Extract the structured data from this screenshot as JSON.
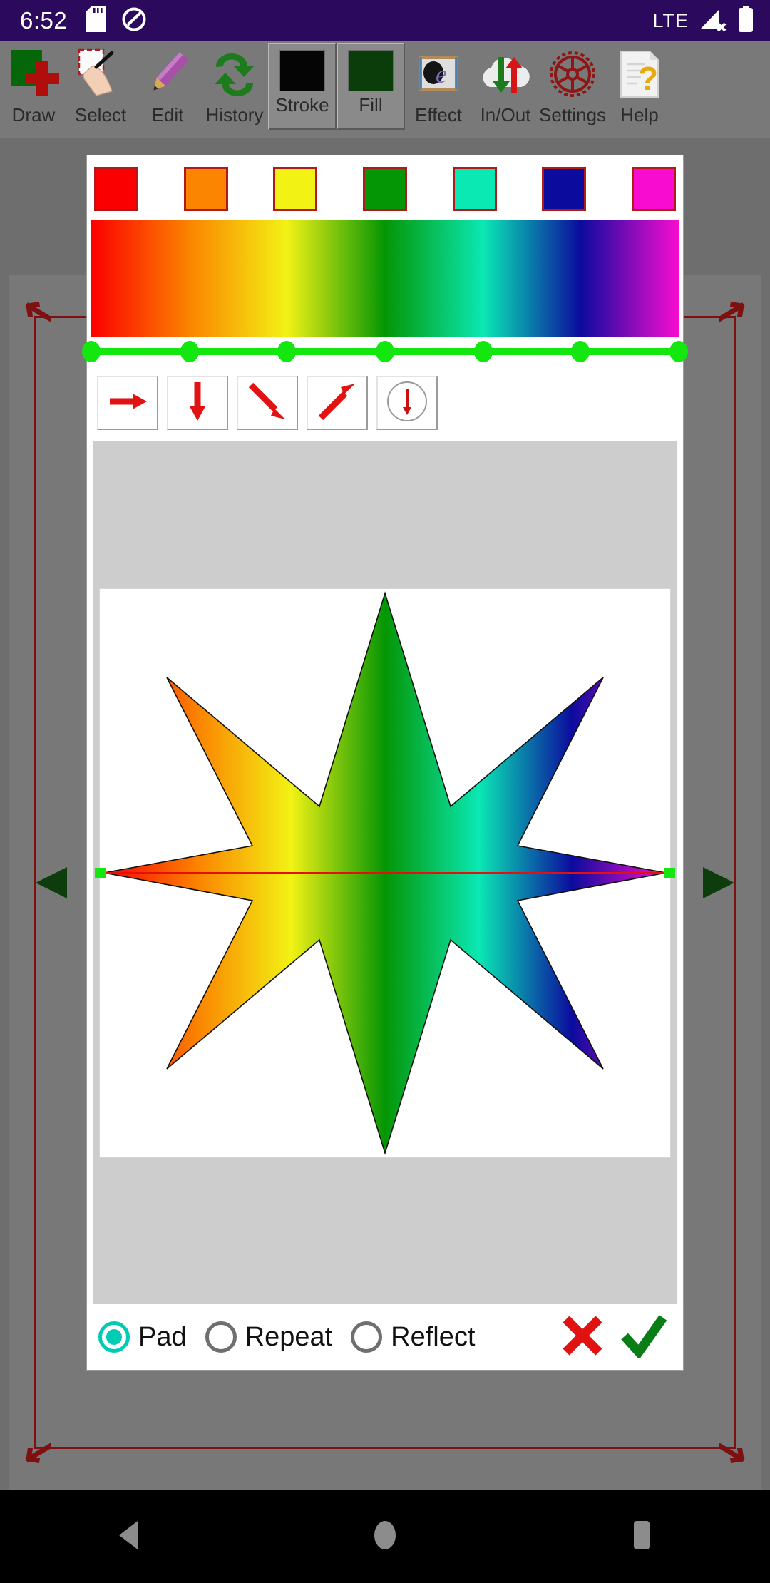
{
  "status_bar": {
    "clock": "6:52",
    "network_label": "LTE",
    "icons": [
      "sd-card-icon",
      "dnd-icon",
      "signal-no-service-icon",
      "battery-icon"
    ]
  },
  "toolbar": {
    "items": [
      {
        "label": "Draw",
        "icon": "draw-new-icon",
        "type": "plain"
      },
      {
        "label": "Select",
        "icon": "select-hand-icon",
        "type": "plain"
      },
      {
        "label": "Edit",
        "icon": "pencil-icon",
        "type": "plain"
      },
      {
        "label": "History",
        "icon": "undo-redo-icon",
        "type": "plain"
      },
      {
        "label": "Stroke",
        "icon": "stroke-swatch",
        "type": "swatch",
        "color": "#050505"
      },
      {
        "label": "Fill",
        "icon": "fill-swatch",
        "type": "swatch",
        "color": "#0b3d0b"
      },
      {
        "label": "Effect",
        "icon": "effect-3d-icon",
        "type": "plain"
      },
      {
        "label": "In/Out",
        "icon": "import-export-icon",
        "type": "plain"
      },
      {
        "label": "Settings",
        "icon": "gear-icon",
        "type": "plain"
      },
      {
        "label": "Help",
        "icon": "help-document-icon",
        "type": "plain"
      }
    ]
  },
  "gradient_dialog": {
    "swatches": [
      {
        "name": "swatch-red",
        "color": "#fb0000"
      },
      {
        "name": "swatch-orange",
        "color": "#fb8400"
      },
      {
        "name": "swatch-yellow",
        "color": "#f2f214"
      },
      {
        "name": "swatch-green",
        "color": "#049604"
      },
      {
        "name": "swatch-spring",
        "color": "#0ae8b4"
      },
      {
        "name": "swatch-navy",
        "color": "#0b0b9e"
      },
      {
        "name": "swatch-magenta",
        "color": "#f80cd0"
      }
    ],
    "gradient_stops": [
      {
        "position": 0,
        "color": "#fb0000"
      },
      {
        "position": 16.7,
        "color": "#fb8400"
      },
      {
        "position": 33.3,
        "color": "#f2f214"
      },
      {
        "position": 50,
        "color": "#049604"
      },
      {
        "position": 66.7,
        "color": "#0ae8b4"
      },
      {
        "position": 83.3,
        "color": "#0b0b9e"
      },
      {
        "position": 100,
        "color": "#f80cd0"
      }
    ],
    "stop_marker_color": "#14e610",
    "direction_buttons": [
      {
        "name": "direction-horizontal-button",
        "icon": "arrow-right-icon",
        "selected": false
      },
      {
        "name": "direction-vertical-button",
        "icon": "arrow-down-icon",
        "selected": false
      },
      {
        "name": "direction-diagonal-down-button",
        "icon": "arrow-down-right-icon",
        "selected": false
      },
      {
        "name": "direction-diagonal-up-button",
        "icon": "arrow-up-right-icon",
        "selected": false
      },
      {
        "name": "direction-radial-button",
        "icon": "radial-gradient-icon",
        "selected": false
      }
    ],
    "preview": {
      "shape": "eight-point-star",
      "background": "#ffffff",
      "axis_color": "#e31010",
      "handle_color": "#14e610"
    },
    "spread_modes": [
      {
        "label": "Pad",
        "selected": true
      },
      {
        "label": "Repeat",
        "selected": false
      },
      {
        "label": "Reflect",
        "selected": false
      }
    ],
    "selected_color": "#00ccb4",
    "actions": [
      {
        "name": "cancel-button",
        "icon": "red-x-icon",
        "color": "#e11212"
      },
      {
        "name": "confirm-button",
        "icon": "green-check-icon",
        "color": "#0a7d16"
      }
    ]
  },
  "document_canvas": {
    "selection_color": "#7d1010",
    "handle_color": "#0d3d0d"
  },
  "nav_bar": {
    "buttons": [
      {
        "name": "nav-back-button",
        "icon": "back-triangle-icon"
      },
      {
        "name": "nav-home-button",
        "icon": "home-circle-icon"
      },
      {
        "name": "nav-recents-button",
        "icon": "recents-square-icon"
      }
    ]
  }
}
